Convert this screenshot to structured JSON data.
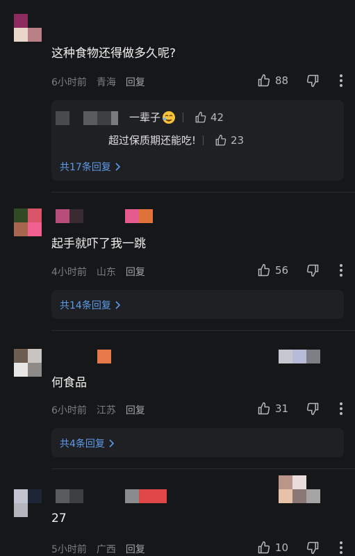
{
  "comments": [
    {
      "text": "这种食物还得做多久呢?",
      "time": "6小时前",
      "location": "青海",
      "reply": "回复",
      "likes": "88"
    },
    {
      "text": "起手就吓了我一跳",
      "time": "4小时前",
      "location": "山东",
      "reply": "回复",
      "likes": "56"
    },
    {
      "text": "何食品",
      "time": "6小时前",
      "location": "江苏",
      "reply": "回复",
      "likes": "31"
    },
    {
      "text": "27",
      "time": "5小时前",
      "location": "广西",
      "reply": "回复",
      "likes": "10"
    }
  ],
  "replies_box_1": {
    "sub1_text": "一辈子",
    "sub1_likes": "42",
    "sub2_text": "超过保质期还能吃!",
    "sub2_likes": "23",
    "more": "共17条回复"
  },
  "replies_box_2": {
    "more": "共14条回复"
  },
  "replies_box_3": {
    "more": "共4条回复"
  },
  "colors": {
    "background": "#161719",
    "link": "#5d9ce8",
    "card": "#1f2023"
  }
}
